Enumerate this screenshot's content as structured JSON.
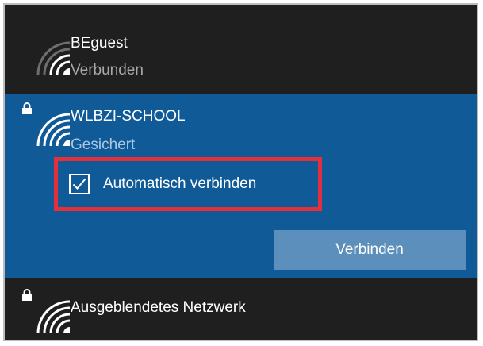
{
  "networks": [
    {
      "ssid": "BEguest",
      "status": "Verbunden",
      "icon": "wifi-icon",
      "secured": false
    },
    {
      "ssid": "WLBZI-SCHOOL",
      "status": "Gesichert",
      "icon": "wifi-icon",
      "secured": true,
      "auto_connect": {
        "label": "Automatisch verbinden",
        "checked": true
      },
      "connect_label": "Verbinden"
    },
    {
      "ssid": "Ausgeblendetes Netzwerk",
      "icon": "wifi-icon",
      "secured": true
    }
  ],
  "colors": {
    "background": "#1f1f1f",
    "selected_background": "#0f5a97",
    "button": "#5d8fbd",
    "highlight_box": "#e3303a"
  }
}
